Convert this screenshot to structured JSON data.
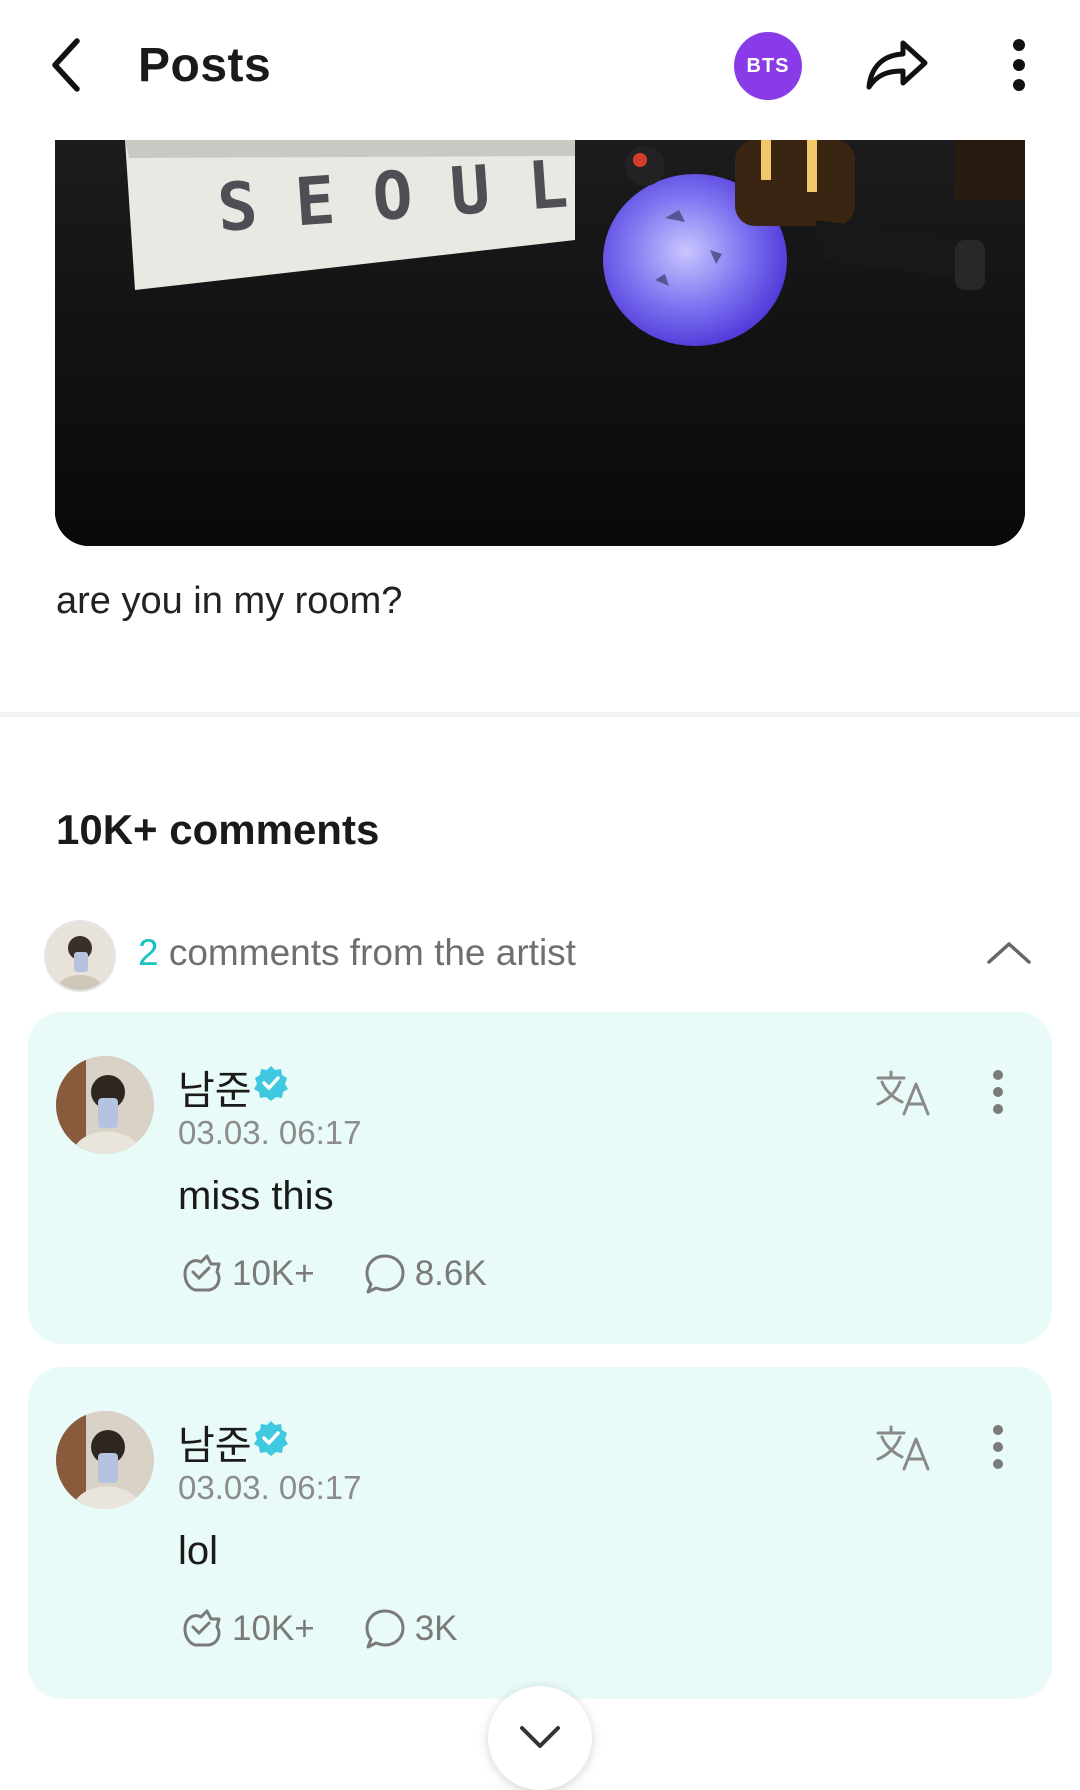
{
  "header": {
    "title": "Posts",
    "badge_text": "BTS",
    "badge_color": "#8a3be8",
    "icons": [
      "back-arrow-icon",
      "share-icon",
      "more-vertical-icon"
    ]
  },
  "post": {
    "image_sign_text": "SEOUL",
    "caption": "are you in my room?"
  },
  "comments": {
    "count_label": "10K+ comments",
    "artist_summary": {
      "count": "2",
      "label": " comments from the artist"
    },
    "items": [
      {
        "author": "남준",
        "time": "03.03. 06:17",
        "text": "miss this",
        "likes": "10K+",
        "replies": "8.6K"
      },
      {
        "author": "남준",
        "time": "03.03. 06:17",
        "text": "lol",
        "likes": "10K+",
        "replies": "3K"
      }
    ]
  },
  "colors": {
    "accent_teal": "#18c4c2",
    "card_bg": "#e9fbf8",
    "verified": "#3ec9e0"
  }
}
